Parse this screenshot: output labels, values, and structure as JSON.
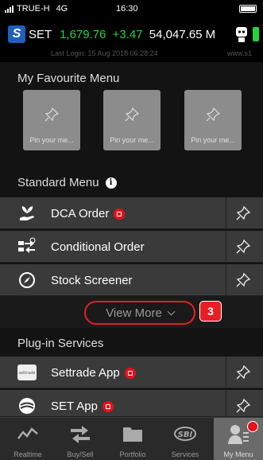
{
  "status_bar": {
    "carrier": "TRUE-H",
    "network": "4G",
    "time": "16:30"
  },
  "ticker": {
    "logo_letter": "S",
    "index_name": "SET",
    "index_value": "1,679.76",
    "change": "+3.47",
    "volume": "54,047.65 M",
    "last_login": "Last Login: 15 Aug 2018 06:28:24",
    "version": "www.s1"
  },
  "favourites": {
    "title": "My Favourite Menu",
    "tiles": [
      {
        "label": "Pin your me..."
      },
      {
        "label": "Pin your me..."
      },
      {
        "label": "Pin your me..."
      }
    ]
  },
  "standard_menu": {
    "title": "Standard Menu",
    "items": [
      {
        "label": "DCA Order",
        "icon": "dca-order-icon",
        "badge": true
      },
      {
        "label": "Conditional Order",
        "icon": "conditional-order-icon",
        "badge": false
      },
      {
        "label": "Stock Screener",
        "icon": "stock-screener-icon",
        "badge": false
      }
    ],
    "view_more_label": "View More",
    "step_label": "3"
  },
  "plugin_services": {
    "title": "Plug-in Services",
    "items": [
      {
        "label": "Settrade App",
        "icon": "settrade-app-icon",
        "badge": true
      },
      {
        "label": "SET App",
        "icon": "set-app-icon",
        "badge": true
      }
    ]
  },
  "tab_bar": {
    "tabs": [
      {
        "label": "Realtime",
        "icon": "realtime-chart-icon",
        "active": false
      },
      {
        "label": "Buy/Sell",
        "icon": "buy-sell-arrows-icon",
        "active": false
      },
      {
        "label": "Portfolio",
        "icon": "portfolio-folder-icon",
        "active": false
      },
      {
        "label": "Services",
        "icon": "services-sbi-icon",
        "active": false
      },
      {
        "label": "My Menu",
        "icon": "my-menu-user-icon",
        "active": true
      }
    ]
  },
  "colors": {
    "accent_green": "#22d43a",
    "highlight_red": "#e81e22",
    "brand_blue": "#1f5fbf"
  }
}
